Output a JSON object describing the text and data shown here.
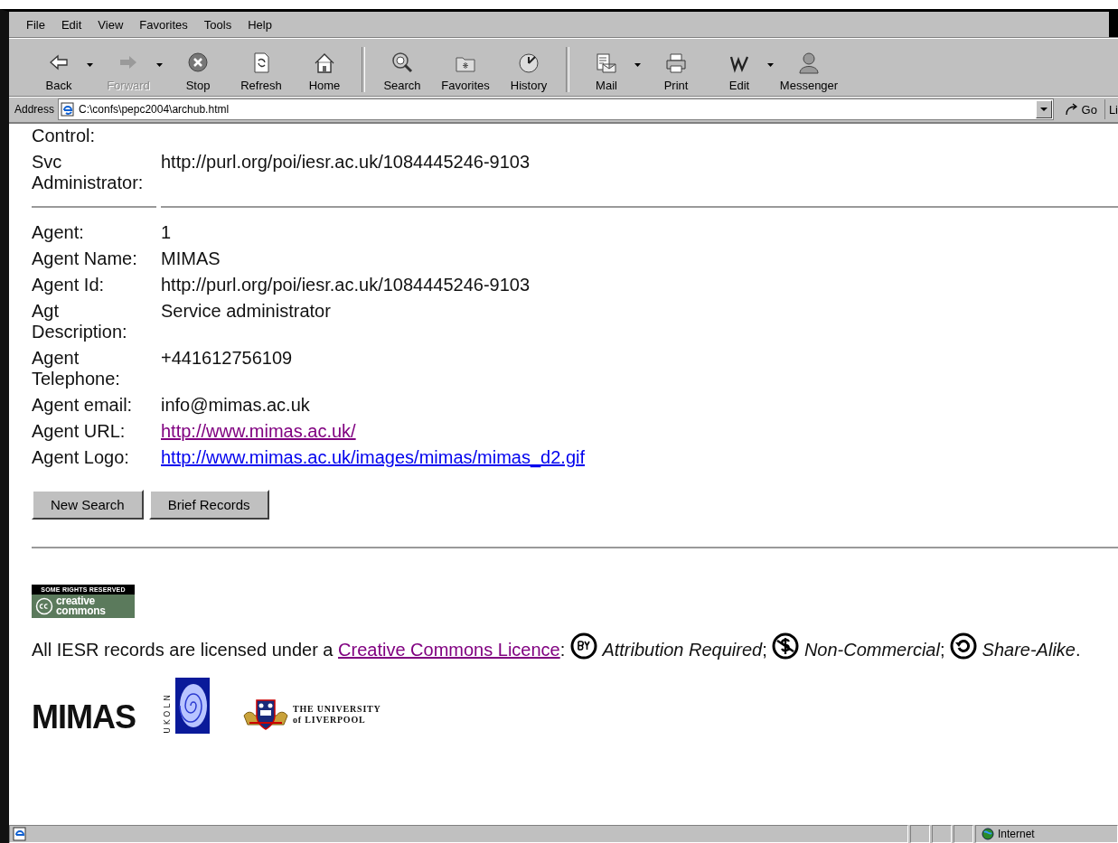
{
  "menu": [
    {
      "label": "File"
    },
    {
      "label": "Edit"
    },
    {
      "label": "View"
    },
    {
      "label": "Favorites"
    },
    {
      "label": "Tools"
    },
    {
      "label": "Help"
    }
  ],
  "toolbar_groups": [
    [
      {
        "label": "Back",
        "disabled": false,
        "dropdown": true
      },
      {
        "label": "Forward",
        "disabled": true,
        "dropdown": true
      },
      {
        "label": "Stop",
        "disabled": false,
        "dropdown": false
      },
      {
        "label": "Refresh",
        "disabled": false,
        "dropdown": false
      },
      {
        "label": "Home",
        "disabled": false,
        "dropdown": false
      }
    ],
    [
      {
        "label": "Search",
        "disabled": false,
        "dropdown": false
      },
      {
        "label": "Favorites",
        "disabled": false,
        "dropdown": false
      },
      {
        "label": "History",
        "disabled": false,
        "dropdown": false
      }
    ],
    [
      {
        "label": "Mail",
        "disabled": false,
        "dropdown": true
      },
      {
        "label": "Print",
        "disabled": false,
        "dropdown": false
      },
      {
        "label": "Edit",
        "disabled": false,
        "dropdown": true
      },
      {
        "label": "Messenger",
        "disabled": false,
        "dropdown": false
      }
    ]
  ],
  "address_bar": {
    "label": "Address",
    "value": "C:\\confs\\pepc2004\\archub.html",
    "go": "Go",
    "links": "Li"
  },
  "service_fields": [
    {
      "label": "Control:",
      "kind": "text"
    },
    {
      "label": "Svc Administrator:",
      "value": "http://purl.org/poi/iesr.ac.uk/1084445246-9103",
      "kind": "text"
    }
  ],
  "agent_fields": [
    {
      "label": "Agent:",
      "value": "1",
      "kind": "text"
    },
    {
      "label": "Agent Name:",
      "value": "MIMAS",
      "kind": "text"
    },
    {
      "label": "Agent Id:",
      "value": "http://purl.org/poi/iesr.ac.uk/1084445246-9103",
      "kind": "text"
    },
    {
      "label": "Agt Description:",
      "value": "Service administrator",
      "kind": "text"
    },
    {
      "label": "Agent Telephone:",
      "value": "+441612756109",
      "kind": "text"
    },
    {
      "label": "Agent email:",
      "value": "info@mimas.ac.uk",
      "kind": "text"
    },
    {
      "label": "Agent URL:",
      "value": "http://www.mimas.ac.uk/",
      "kind": "link",
      "visited": true
    },
    {
      "label": "Agent Logo:",
      "value": "http://www.mimas.ac.uk/images/mimas/mimas_d2.gif",
      "kind": "link",
      "visited": false
    }
  ],
  "buttons": [
    "New Search",
    "Brief Records"
  ],
  "cc_badge": {
    "top": "SOME RIGHTS RESERVED",
    "line1": "creative",
    "line2": "commons"
  },
  "licence": [
    {
      "kind": "text",
      "text": "All IESR records are licensed under a "
    },
    {
      "kind": "link",
      "text": "Creative Commons Licence",
      "visited": true
    },
    {
      "kind": "text",
      "text": ": "
    },
    {
      "kind": "by"
    },
    {
      "kind": "text",
      "text": " *Attribution Required*; "
    },
    {
      "kind": "nc"
    },
    {
      "kind": "text",
      "text": " *Non-Commercial*; "
    },
    {
      "kind": "sa"
    },
    {
      "kind": "text",
      "text": " *Share-Alike*."
    }
  ],
  "partner_logos": [
    {
      "kind": "mimas",
      "text": "MIMAS"
    },
    {
      "kind": "ukoln",
      "text": "UKOLN"
    },
    {
      "kind": "liverpool",
      "line1": "THE UNIVERSITY",
      "line2": "of LIVERPOOL"
    }
  ],
  "status_bar": {
    "zone": "Internet"
  }
}
